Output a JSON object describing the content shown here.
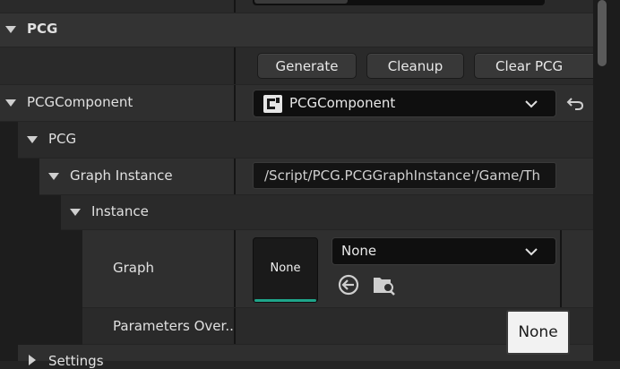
{
  "categories": {
    "pcg": "PCG"
  },
  "buttons": {
    "generate": "Generate",
    "cleanup": "Cleanup",
    "clear": "Clear PCG"
  },
  "rows": {
    "pcg_component_label": "PCGComponent",
    "pcg_component_value": "PCGComponent",
    "pcg_sub_label": "PCG",
    "graph_instance_label": "Graph Instance",
    "graph_instance_value": "/Script/PCG.PCGGraphInstance'/Game/Th",
    "instance_label": "Instance",
    "graph_label": "Graph",
    "graph_thumb": "None",
    "graph_combo": "None",
    "params_label": "Parameters Over...",
    "params_button": "None",
    "settings_label": "Settings"
  },
  "colors": {
    "thumb_underline": "#1fa58a"
  }
}
